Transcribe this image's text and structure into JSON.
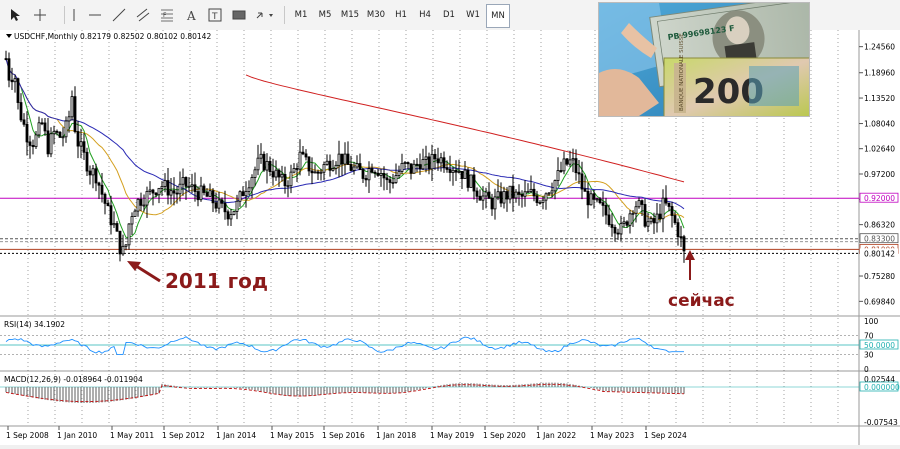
{
  "toolbar": {
    "timeframes": [
      "M1",
      "M5",
      "M15",
      "M30",
      "H1",
      "H4",
      "D1",
      "W1",
      "MN"
    ],
    "active_timeframe": "MN"
  },
  "chart": {
    "header": "USDCHF,Monthly  0.82179 0.82502 0.80102 0.80142",
    "price_labels": [
      "1.24560",
      "1.18960",
      "1.13520",
      "1.08040",
      "1.02640",
      "0.97200",
      "0.91760",
      "0.86320",
      "0.80142",
      "0.75280",
      "0.69840"
    ],
    "marked_levels": [
      {
        "value": "0.92000",
        "color": "#c000c0"
      },
      {
        "value": "0.83300",
        "color": "#555555"
      },
      {
        "value": "0.81000",
        "color": "#b04020"
      },
      {
        "value": "0.80142",
        "color": "#000000"
      }
    ],
    "time_labels": [
      "1 Sep 2008",
      "1 Jan 2010",
      "1 May 2011",
      "1 Sep 2012",
      "1 Jan 2014",
      "1 May 2015",
      "1 Sep 2016",
      "1 Jan 2018",
      "1 May 2019",
      "1 Sep 2020",
      "1 Jan 2022",
      "1 May 2023",
      "1 Sep 2024"
    ],
    "annotation_2011": "2011 год",
    "annotation_now": "сейчас",
    "annotation_color": "#8b1a1a"
  },
  "rsi": {
    "header": "RSI(14) 34.1902",
    "labels": [
      "100",
      "70",
      "50.0000",
      "30",
      "0"
    ]
  },
  "macd": {
    "header": "MACD(12,26,9) -0.018964 -0.011904",
    "labels": [
      "0.02544",
      "0.000000",
      "-0.07543"
    ]
  },
  "photo": {
    "banknote_text": "200",
    "serial": "PB 99698123 F",
    "bank_name": "BANQUE NATIONALE SUISSE"
  }
}
